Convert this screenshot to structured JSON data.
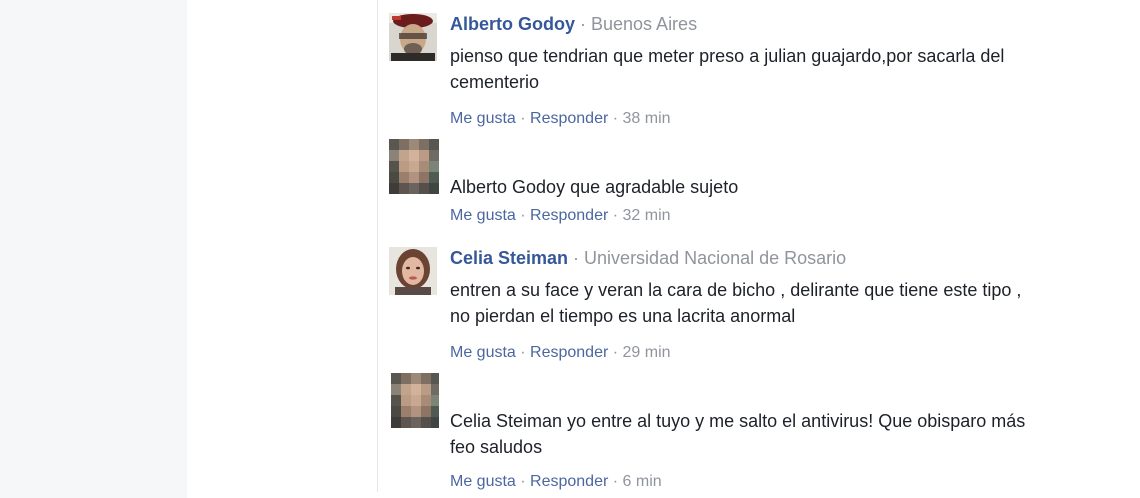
{
  "colors": {
    "link": "#365899",
    "meta": "#90949c",
    "text": "#1d2129"
  },
  "comments": [
    {
      "author": "Alberto Godoy",
      "affiliation": "Buenos Aires",
      "text": "pienso que tendrian que meter preso a julian guajardo,por sacarla del cementerio",
      "like_label": "Me gusta",
      "reply_label": "Responder",
      "time": "38 min"
    },
    {
      "author": "",
      "affiliation": "",
      "text": "Alberto Godoy que agradable sujeto",
      "like_label": "Me gusta",
      "reply_label": "Responder",
      "time": "32 min"
    },
    {
      "author": "Celia Steiman",
      "affiliation": "Universidad Nacional de Rosario",
      "text": "entren a su face y veran la cara de bicho , delirante que tiene este tipo , no pierdan el tiempo es una lacrita anormal",
      "like_label": "Me gusta",
      "reply_label": "Responder",
      "time": "29 min"
    },
    {
      "author": "",
      "affiliation": "",
      "text": "Celia Steiman yo entre al tuyo y me salto el antivirus! Que obisparo más feo saludos",
      "like_label": "Me gusta",
      "reply_label": "Responder",
      "time": "6 min"
    }
  ],
  "separator": " · "
}
